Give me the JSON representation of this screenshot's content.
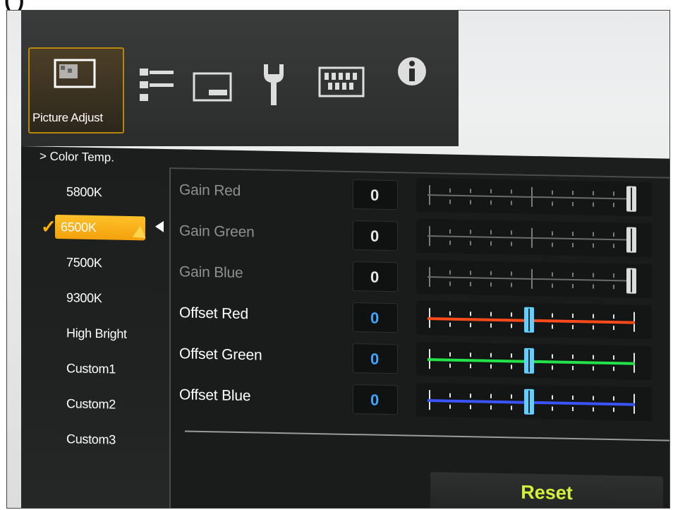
{
  "heading_fragment": "(                )",
  "menu": {
    "active_tab_label": "Picture Adjust",
    "tabs": [
      {
        "icon": "picture-adjust-icon"
      },
      {
        "icon": "connections-icon"
      },
      {
        "icon": "display-icon"
      },
      {
        "icon": "wrench-icon"
      },
      {
        "icon": "grid-pattern-icon"
      },
      {
        "icon": "info-icon"
      }
    ]
  },
  "breadcrumb": "> Color Temp.",
  "color_temps": [
    {
      "label": "5800K"
    },
    {
      "label": "6500K",
      "selected": true
    },
    {
      "label": "7500K"
    },
    {
      "label": "9300K"
    },
    {
      "label": "High Bright"
    },
    {
      "label": "Custom1"
    },
    {
      "label": "Custom2"
    },
    {
      "label": "Custom3"
    }
  ],
  "settings": [
    {
      "label": "Gain Red",
      "value": "0",
      "active": false,
      "slider_level": 1.0,
      "color": "#888888"
    },
    {
      "label": "Gain Green",
      "value": "0",
      "active": false,
      "slider_level": 1.0,
      "color": "#888888"
    },
    {
      "label": "Gain Blue",
      "value": "0",
      "active": false,
      "slider_level": 1.0,
      "color": "#888888"
    },
    {
      "label": "Offset Red",
      "value": "0",
      "active": true,
      "slider_level": 0.5,
      "color": "#ff4a1c"
    },
    {
      "label": "Offset Green",
      "value": "0",
      "active": true,
      "slider_level": 0.5,
      "color": "#22e34a"
    },
    {
      "label": "Offset Blue",
      "value": "0",
      "active": true,
      "slider_level": 0.5,
      "color": "#3a54ff"
    }
  ],
  "reset_label": "Reset",
  "colors": {
    "accent": "#f5a80e",
    "value_active": "#3ea6ff",
    "reset_text": "#d4f03a",
    "handle": "#5fd0ff"
  }
}
